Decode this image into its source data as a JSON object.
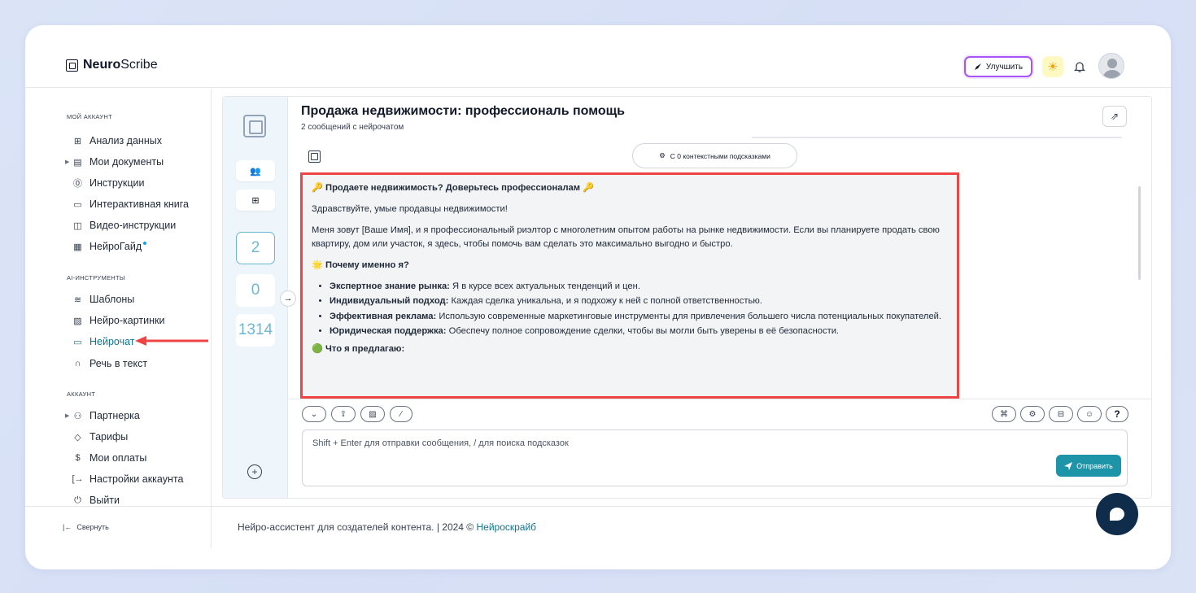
{
  "app": {
    "logo_bold": "Neuro",
    "logo_light": "Scribe"
  },
  "topbar": {
    "upgrade_label": "Улучшить"
  },
  "sidebar": {
    "sections": [
      {
        "title": "МОЙ АККАУНТ"
      },
      {
        "title": "AI-ИНСТРУМЕНТЫ"
      },
      {
        "title": "АККАУНТ"
      }
    ],
    "account_items": [
      {
        "label": "Анализ данных",
        "icon": "grid-icon"
      },
      {
        "label": "Мои документы",
        "icon": "document-icon"
      },
      {
        "label": "Инструкции",
        "icon": "help-circle-icon"
      },
      {
        "label": "Интерактивная книга",
        "icon": "book-icon"
      },
      {
        "label": "Видео-инструкции",
        "icon": "video-icon"
      },
      {
        "label": "НейроГайд",
        "icon": "calendar-icon"
      }
    ],
    "ai_items": [
      {
        "label": "Шаблоны",
        "icon": "layers-icon"
      },
      {
        "label": "Нейро-картинки",
        "icon": "image-icon"
      },
      {
        "label": "Нейрочат",
        "icon": "chat-icon"
      },
      {
        "label": "Речь в текст",
        "icon": "headphones-icon"
      }
    ],
    "settings_items": [
      {
        "label": "Партнерка",
        "icon": "users-icon"
      },
      {
        "label": "Тарифы",
        "icon": "tag-icon"
      },
      {
        "label": "Мои оплаты",
        "icon": "dollar-icon"
      },
      {
        "label": "Настройки аккаунта",
        "icon": "login-icon"
      },
      {
        "label": "Выйти",
        "icon": "power-icon"
      }
    ],
    "collapse_label": "Свернуть"
  },
  "chat": {
    "title": "Продажа недвижимости: профессиональ помощь",
    "subtitle": "2 сообщений с нейрочатом",
    "context_pill": "С 0 контекстными подсказками",
    "rail_counts": [
      "2",
      "0",
      "1314"
    ],
    "message": {
      "heading": "🔑 Продаете недвижимость? Доверьтесь профессионалам 🔑",
      "greeting": "Здравствуйте, умые продавцы недвижимости!",
      "intro": "Меня зовут [Ваше Имя], и я профессиональный риэлтор с многолетним опытом работы на рынке недвижимости. Если вы планируете продать свою квартиру, дом или участок, я здесь, чтобы помочь вам сделать это максимально выгодно и быстро.",
      "why_heading": "🌟 Почему именно я?",
      "bullets": [
        {
          "bold": "Экспертное знание рынка:",
          "text": " Я в курсе всех актуальных тенденций и цен."
        },
        {
          "bold": "Индивидуальный подход:",
          "text": " Каждая сделка уникальна, и я подхожу к ней с полной ответственностью."
        },
        {
          "bold": "Эффективная реклама:",
          "text": " Использую современные маркетинговые инструменты для привлечения большего числа потенциальных покупателей."
        },
        {
          "bold": "Юридическая поддержка:",
          "text": " Обеспечу полное сопровождение сделки, чтобы вы могли быть уверены в её безопасности."
        }
      ],
      "offer_heading": "🟢 Что я предлагаю:"
    },
    "input_placeholder": "Shift + Enter для отправки сообщения, / для поиска подсказок",
    "send_label": "Отправить",
    "help_label": "?"
  },
  "footer": {
    "text": "Нейро-ассистент для создателей контента.  | 2024 © ",
    "link": "Нейроскрайб"
  },
  "colors": {
    "accent": "#1e94a8",
    "highlight": "#ef4444",
    "upgrade_border": "#a855f7"
  }
}
